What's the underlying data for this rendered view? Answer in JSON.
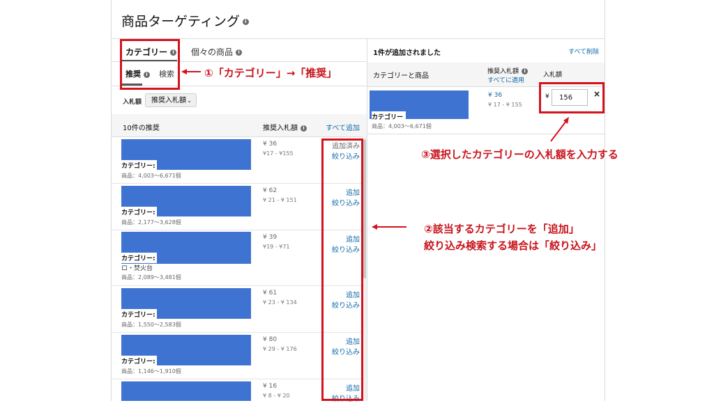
{
  "header": {
    "title": "商品ターゲティング"
  },
  "tabs": {
    "category": "カテゴリー",
    "individual": "個々の商品"
  },
  "subtabs": {
    "recommended": "推奨",
    "search": "検索"
  },
  "bid_filter": {
    "label": "入札額",
    "value": "推奨入札額"
  },
  "list": {
    "heading": "10件の推奨",
    "bid_column": "推奨入札額",
    "add_all": "すべて追加",
    "category_prefix": "カテゴリー:",
    "rows": [
      {
        "bid": "¥ 36",
        "range": "¥17 - ¥155",
        "products": "商品：4,003～6,671個",
        "action1": "追加済み",
        "action2": "絞り込み",
        "sub": ""
      },
      {
        "bid": "¥ 62",
        "range": "¥ 21 - ¥ 151",
        "products": "商品：2,177～3,628個",
        "action1": "追加",
        "action2": "絞り込み",
        "sub": ""
      },
      {
        "bid": "¥ 39",
        "range": "¥19 - ¥71",
        "products": "商品：2,089～3,481個",
        "action1": "追加",
        "action2": "絞り込み",
        "sub": "ロ・焚火台"
      },
      {
        "bid": "¥ 61",
        "range": "¥ 23 - ¥ 134",
        "products": "商品：1,550～2,583個",
        "action1": "追加",
        "action2": "絞り込み",
        "sub": ""
      },
      {
        "bid": "¥ 80",
        "range": "¥ 29 - ¥ 176",
        "products": "商品：1,146～1,910個",
        "action1": "追加",
        "action2": "絞り込み",
        "sub": ""
      },
      {
        "bid": "¥ 16",
        "range": "¥ 8 - ¥ 20",
        "products": "",
        "action1": "追加",
        "action2": "絞り込み",
        "sub": ""
      }
    ]
  },
  "selected": {
    "count_text": "1件が追加されました",
    "remove_all": "すべて削除",
    "col_category": "カテゴリーと商品",
    "col_suggested": "推奨入札額",
    "apply_all": "すべてに適用",
    "col_bid": "入札額",
    "item": {
      "category_prefix": "カテゴリー",
      "products": "商品：4,003～6,671個",
      "bid": "¥ 36",
      "range": "¥ 17 - ¥ 155",
      "currency": "¥",
      "bid_value": "156",
      "remove": "×"
    }
  },
  "annotations": {
    "a1": "①「カテゴリー」→「推奨」",
    "a2_line1": "②該当するカテゴリーを「追加」",
    "a2_line2": "絞り込み検索する場合は「絞り込み」",
    "a3": "③選択したカテゴリーの入札額を入力する"
  },
  "colors": {
    "annotation_red": "#d4121c",
    "link_blue": "#0f6aa8",
    "redacted_blue": "#3e73d2"
  }
}
